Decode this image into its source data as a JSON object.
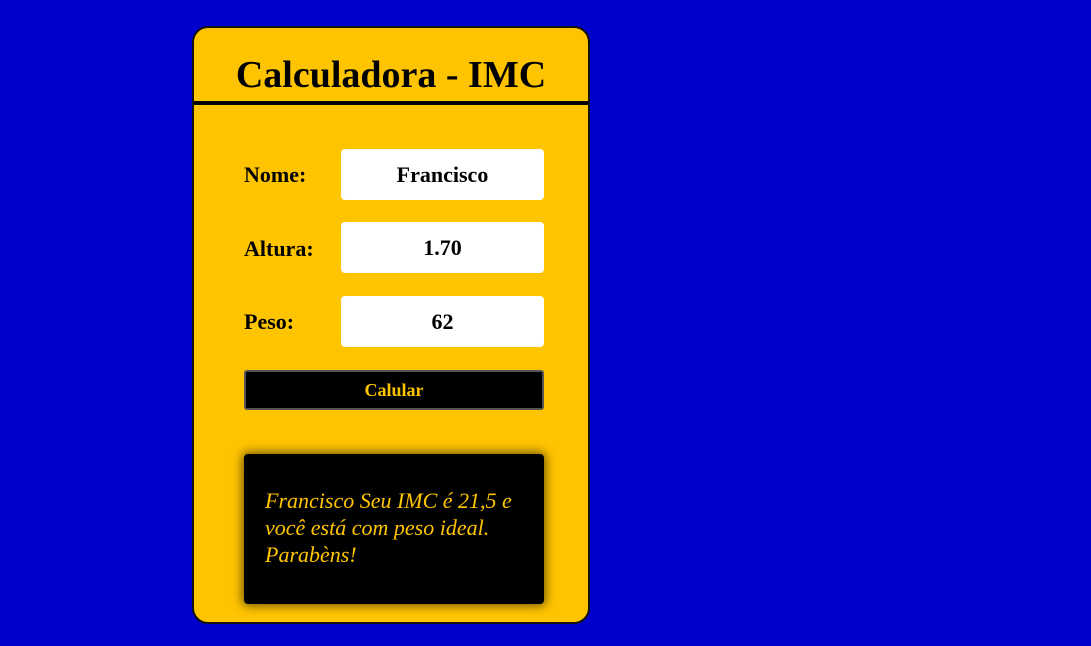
{
  "colors": {
    "background": "#0000cc",
    "card": "#ffc400",
    "accent_text": "#ffc400",
    "dark": "#000000"
  },
  "card": {
    "title": "Calculadora - IMC"
  },
  "form": {
    "nome_label": "Nome:",
    "nome_value": "Francisco",
    "altura_label": "Altura:",
    "altura_value": "1.70",
    "peso_label": "Peso:",
    "peso_value": "62",
    "button_label": "Calular"
  },
  "result": {
    "message": "Francisco Seu IMC é 21,5 e você está com peso ideal. Parabèns!"
  }
}
